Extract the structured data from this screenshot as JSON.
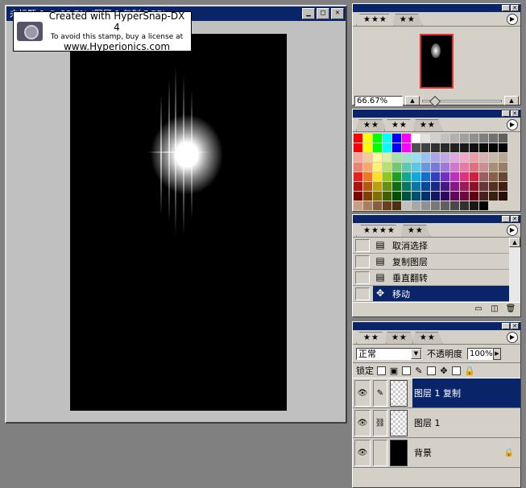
{
  "document": {
    "title": "未标题-1 @ 66.7% (图层 1 复制,RGB)"
  },
  "stamp": {
    "line1": "Created with HyperSnap-DX 4",
    "line2": "To avoid this stamp, buy a license at",
    "line3": "www.Hyperionics.com"
  },
  "navigator": {
    "tabs": [
      "★★★",
      "★★"
    ],
    "zoom": "66.67%"
  },
  "swatches": {
    "tabs": [
      "★★",
      "★★",
      "★★"
    ],
    "colors": [
      "#ff0000",
      "#ffff00",
      "#00ff00",
      "#00ffff",
      "#0000ff",
      "#ff00ff",
      "#ffffff",
      "#e0e0e0",
      "#d0d0d0",
      "#c0c0c0",
      "#b0b0b0",
      "#a0a0a0",
      "#909090",
      "#808080",
      "#707070",
      "#606060",
      "#ff0000",
      "#ffff00",
      "#00ff00",
      "#00ffff",
      "#0000ff",
      "#ff00ff",
      "#505050",
      "#404040",
      "#303030",
      "#282828",
      "#202020",
      "#181818",
      "#101010",
      "#080808",
      "#040404",
      "#000000",
      "#f4a8a0",
      "#f8c898",
      "#fff8a0",
      "#d8f0a0",
      "#a8e0a8",
      "#a0e0d0",
      "#98e0f0",
      "#98c0f0",
      "#a8a8e8",
      "#c0a8e8",
      "#e0a8e0",
      "#f0a8c8",
      "#e8a0a8",
      "#d8b0b0",
      "#c8b8a8",
      "#b8a898",
      "#f08070",
      "#f8a868",
      "#fff070",
      "#b8e070",
      "#70c870",
      "#60c8b0",
      "#58c8e8",
      "#6898e0",
      "#7878d8",
      "#a078d8",
      "#d078d0",
      "#e878a8",
      "#e07080",
      "#c89090",
      "#a89078",
      "#988068",
      "#e82020",
      "#f07820",
      "#ffe020",
      "#90c820",
      "#20a020",
      "#10a890",
      "#10a8e0",
      "#1070d0",
      "#3040c0",
      "#7030c0",
      "#c030c0",
      "#e03080",
      "#d02040",
      "#986060",
      "#886048",
      "#684830",
      "#b01010",
      "#b85810",
      "#b8a010",
      "#689010",
      "#107010",
      "#087860",
      "#0878a8",
      "#084898",
      "#182888",
      "#481888",
      "#881888",
      "#a01858",
      "#901028",
      "#683838",
      "#583020",
      "#402010",
      "#800000",
      "#804000",
      "#807000",
      "#406000",
      "#005000",
      "#005040",
      "#005070",
      "#003070",
      "#101860",
      "#300860",
      "#600860",
      "#700840",
      "#600010",
      "#482020",
      "#382010",
      "#281008",
      "#c8a080",
      "#a88060",
      "#886040",
      "#684020",
      "#483010",
      "#c0c0c0",
      "#a8a8a8",
      "#909090",
      "#787878",
      "#606060",
      "#484848",
      "#303030",
      "#181818",
      "#000000",
      "#d4d0c8",
      "#d4d0c8"
    ]
  },
  "history": {
    "tabs": [
      "★★★★",
      "★★"
    ],
    "items": [
      {
        "label": "取消选择",
        "icon": "script-icon"
      },
      {
        "label": "复制图层",
        "icon": "script-icon"
      },
      {
        "label": "垂直翻转",
        "icon": "script-icon"
      },
      {
        "label": "移动",
        "icon": "move-icon",
        "selected": true
      }
    ]
  },
  "layers": {
    "tabs": [
      "★★",
      "★★",
      "★★"
    ],
    "blend_mode": "正常",
    "opacity_label": "不透明度",
    "opacity_value": "100%",
    "lock_label": "锁定",
    "items": [
      {
        "name": "图层 1 复制",
        "selected": true
      },
      {
        "name": "图层 1",
        "selected": false
      },
      {
        "name": "背景",
        "selected": false,
        "locked": true
      }
    ]
  }
}
